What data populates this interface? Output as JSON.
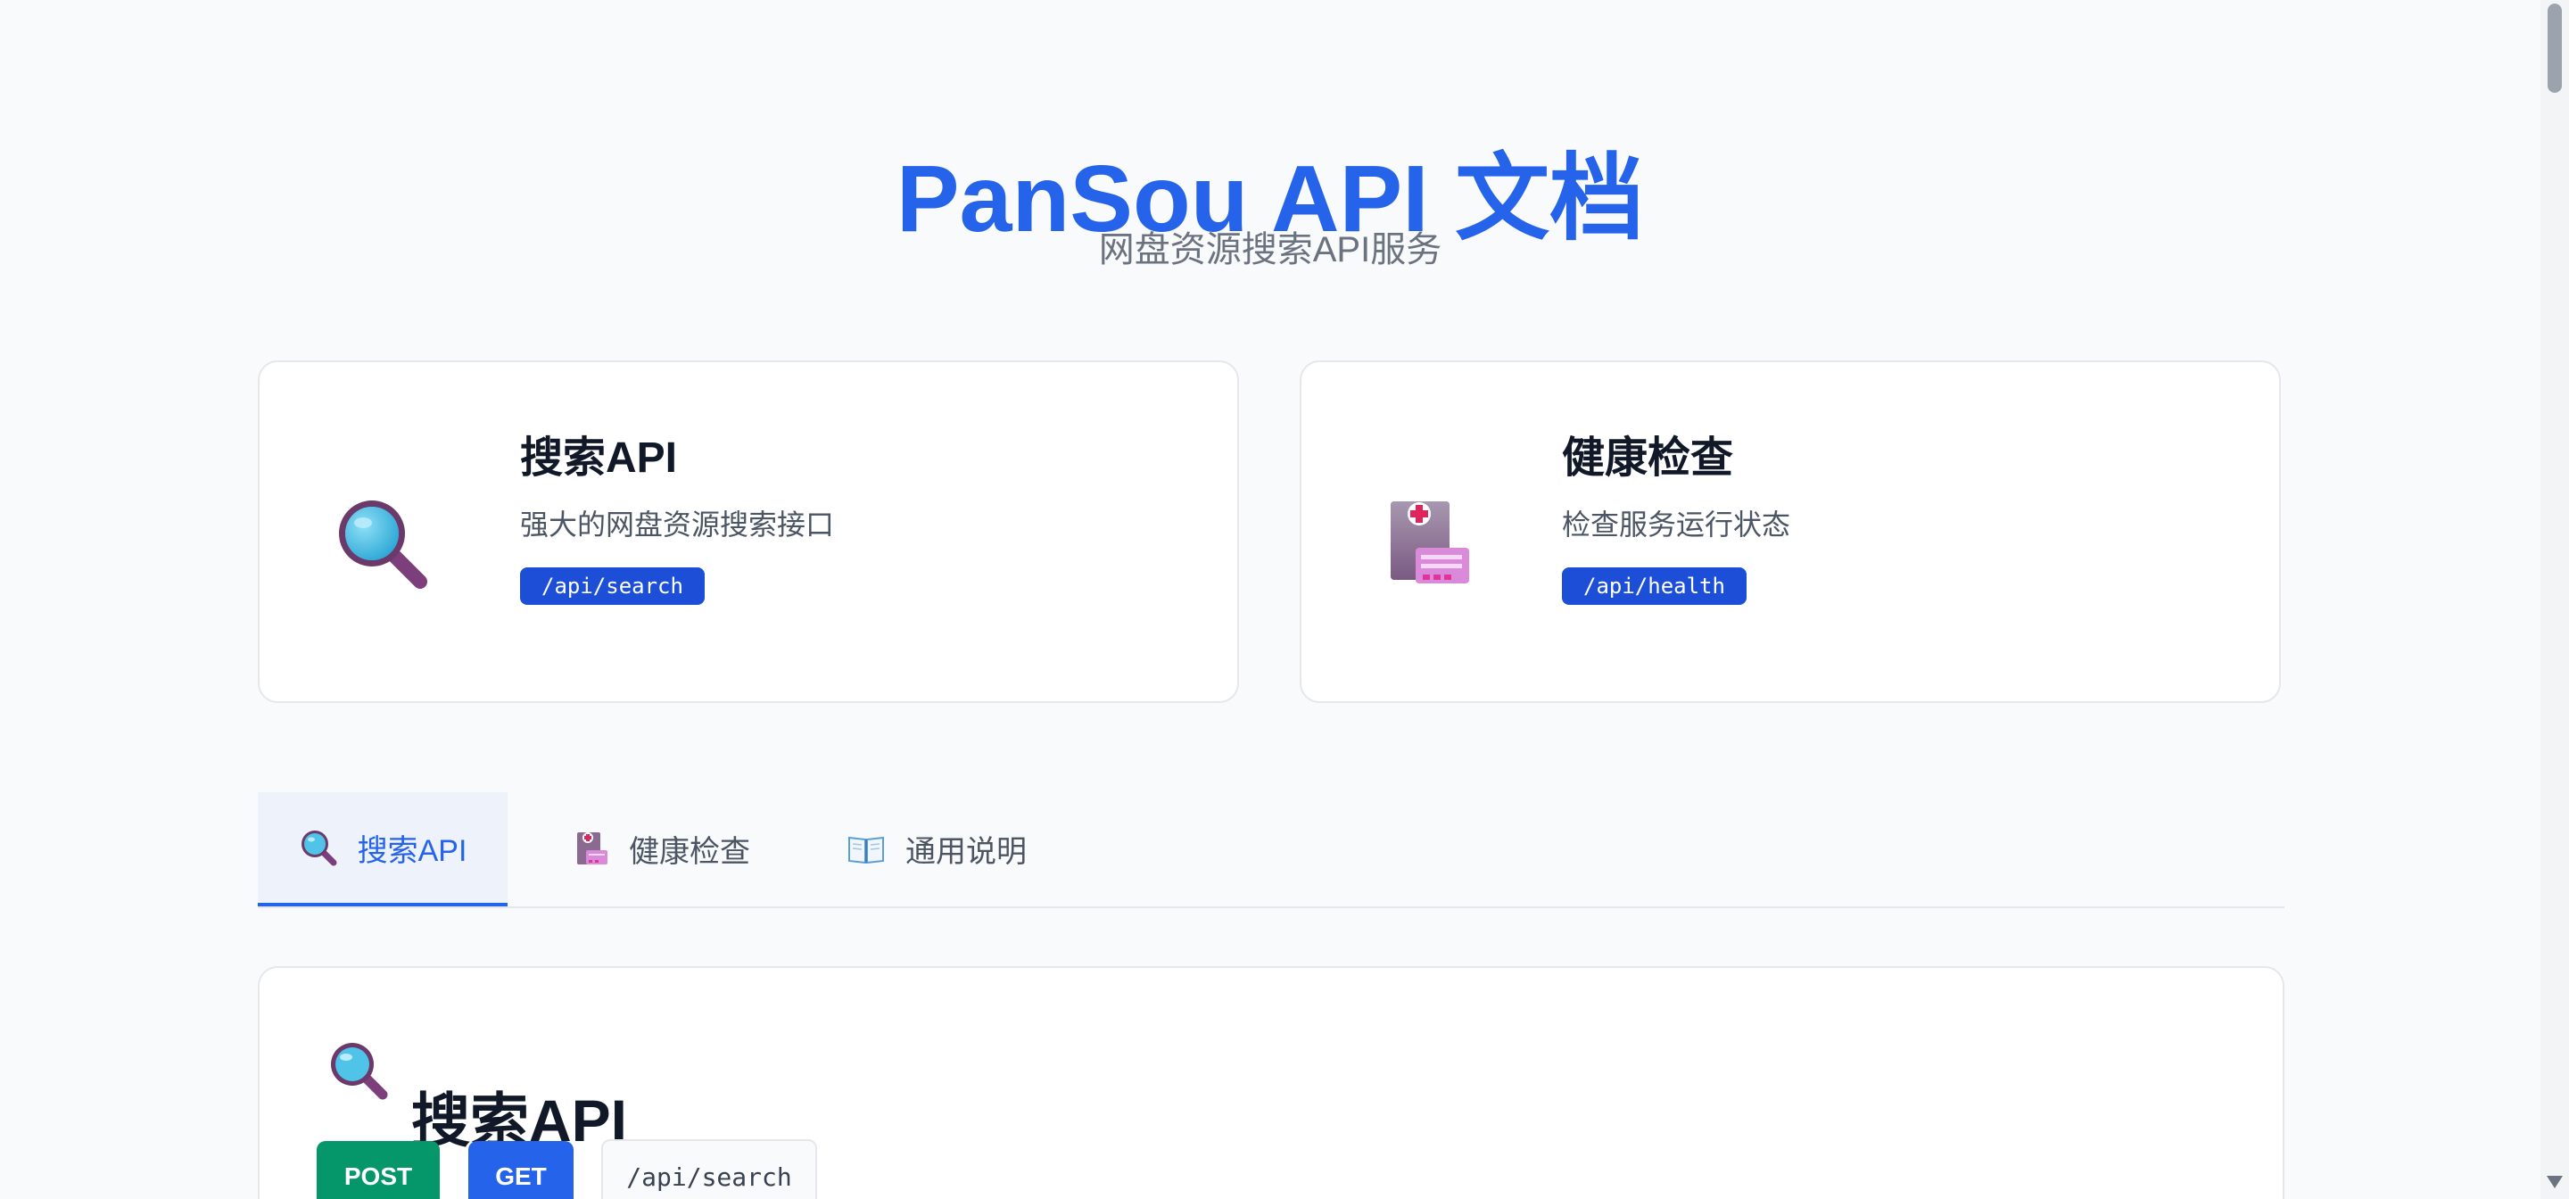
{
  "header": {
    "title": "PanSou API 文档",
    "subtitle": "网盘资源搜索API服务"
  },
  "cards": [
    {
      "title": "搜索API",
      "description": "强大的网盘资源搜索接口",
      "endpoint": "/api/search",
      "icon": "magnifier-icon"
    },
    {
      "title": "健康检查",
      "description": "检查服务运行状态",
      "endpoint": "/api/health",
      "icon": "health-record-icon"
    }
  ],
  "tabs": [
    {
      "label": "搜索API",
      "icon": "magnifier-icon",
      "active": true
    },
    {
      "label": "健康检查",
      "icon": "health-record-icon",
      "active": false
    },
    {
      "label": "通用说明",
      "icon": "open-book-icon",
      "active": false
    }
  ],
  "panel": {
    "title": "搜索API",
    "methods": [
      "POST",
      "GET"
    ],
    "path": "/api/search"
  },
  "colors": {
    "accent": "#2563eb",
    "post": "#059669",
    "get": "#2563eb",
    "badge": "#1d4ed8"
  }
}
